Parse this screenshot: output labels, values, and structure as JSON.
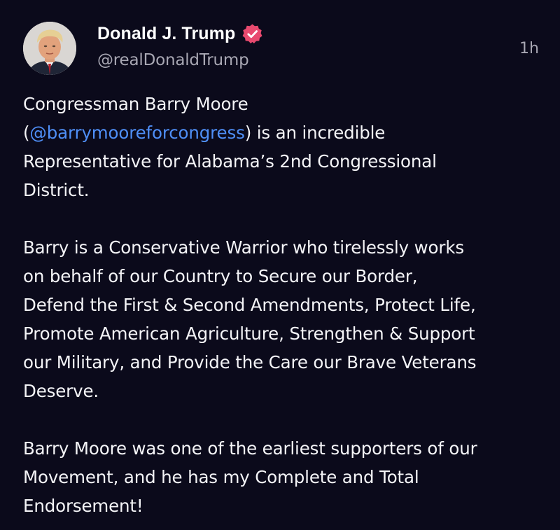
{
  "author": {
    "display_name": "Donald J. Trump",
    "handle": "@realDonaldTrump",
    "verified": true,
    "avatar_icon": "profile-photo",
    "verified_icon": "verified-badge-icon"
  },
  "timestamp": "1h",
  "colors": {
    "background": "#0b0a1b",
    "text": "#f4f4f7",
    "secondary_text": "#a8a7b3",
    "mention": "#4f8ff7",
    "verified_badge": "#e84a6f"
  },
  "post": {
    "p1": {
      "line1": "Congressman Barry Moore",
      "line2_open": "(",
      "line2_mention": "@barrymooreforcongress",
      "line2_rest": ") is an incredible",
      "line3": "Representative for Alabama’s 2nd Congressional",
      "line4": "District."
    },
    "p2": {
      "line1": "Barry is a Conservative Warrior who tirelessly works",
      "line2": "on behalf of our Country to Secure our Border,",
      "line3": "Defend the First & Second Amendments, Protect Life,",
      "line4": "Promote American Agriculture, Strengthen & Support",
      "line5": "our Military, and Provide the Care our Brave Veterans",
      "line6": "Deserve."
    },
    "p3": {
      "line1": "Barry Moore was one of the earliest supporters of our",
      "line2": "Movement, and he has my Complete and Total",
      "line3": "Endorsement!"
    }
  }
}
